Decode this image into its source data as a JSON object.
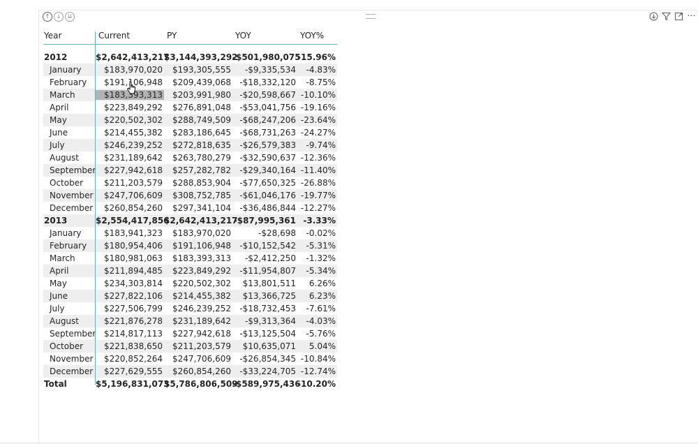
{
  "toolbar": {
    "drill_icons": [
      "drill-up-icon",
      "drill-down-icon",
      "expand-all-icon"
    ],
    "right_icons": [
      "drill-mode-icon",
      "filter-icon",
      "focus-mode-icon",
      "more-options-icon"
    ],
    "more_label": "···"
  },
  "table": {
    "columns": [
      "Year",
      "Current",
      "PY",
      "YOY",
      "YOY%"
    ],
    "rows": [
      {
        "type": "year",
        "cells": [
          "2012",
          "$2,642,413,217",
          "$3,144,393,292",
          "-$501,980,075",
          "-15.96%"
        ]
      },
      {
        "type": "month",
        "cells": [
          "January",
          "$183,970,020",
          "$193,305,555",
          "-$9,335,534",
          "-4.83%"
        ]
      },
      {
        "type": "month",
        "cells": [
          "February",
          "$191,106,948",
          "$209,439,068",
          "-$18,332,120",
          "-8.75%"
        ]
      },
      {
        "type": "month",
        "cells": [
          "March",
          "$183,393,313",
          "$203,991,980",
          "-$20,598,667",
          "-10.10%"
        ],
        "selected_col": 1
      },
      {
        "type": "month",
        "cells": [
          "April",
          "$223,849,292",
          "$276,891,048",
          "-$53,041,756",
          "-19.16%"
        ]
      },
      {
        "type": "month",
        "cells": [
          "May",
          "$220,502,302",
          "$288,749,509",
          "-$68,247,206",
          "-23.64%"
        ]
      },
      {
        "type": "month",
        "cells": [
          "June",
          "$214,455,382",
          "$283,186,645",
          "-$68,731,263",
          "-24.27%"
        ]
      },
      {
        "type": "month",
        "cells": [
          "July",
          "$246,239,252",
          "$272,818,635",
          "-$26,579,383",
          "-9.74%"
        ]
      },
      {
        "type": "month",
        "cells": [
          "August",
          "$231,189,642",
          "$263,780,279",
          "-$32,590,637",
          "-12.36%"
        ]
      },
      {
        "type": "month",
        "cells": [
          "September",
          "$227,942,618",
          "$257,282,782",
          "-$29,340,164",
          "-11.40%"
        ]
      },
      {
        "type": "month",
        "cells": [
          "October",
          "$211,203,579",
          "$288,853,904",
          "-$77,650,325",
          "-26.88%"
        ]
      },
      {
        "type": "month",
        "cells": [
          "November",
          "$247,706,609",
          "$308,752,785",
          "-$61,046,176",
          "-19.77%"
        ]
      },
      {
        "type": "month",
        "cells": [
          "December",
          "$260,854,260",
          "$297,341,104",
          "-$36,486,844",
          "-12.27%"
        ]
      },
      {
        "type": "year",
        "cells": [
          "2013",
          "$2,554,417,856",
          "$2,642,413,217",
          "-$87,995,361",
          "-3.33%"
        ]
      },
      {
        "type": "month",
        "cells": [
          "January",
          "$183,941,323",
          "$183,970,020",
          "-$28,698",
          "-0.02%"
        ]
      },
      {
        "type": "month",
        "cells": [
          "February",
          "$180,954,406",
          "$191,106,948",
          "-$10,152,542",
          "-5.31%"
        ]
      },
      {
        "type": "month",
        "cells": [
          "March",
          "$180,981,063",
          "$183,393,313",
          "-$2,412,250",
          "-1.32%"
        ]
      },
      {
        "type": "month",
        "cells": [
          "April",
          "$211,894,485",
          "$223,849,292",
          "-$11,954,807",
          "-5.34%"
        ]
      },
      {
        "type": "month",
        "cells": [
          "May",
          "$234,303,814",
          "$220,502,302",
          "$13,801,511",
          "6.26%"
        ]
      },
      {
        "type": "month",
        "cells": [
          "June",
          "$227,822,106",
          "$214,455,382",
          "$13,366,725",
          "6.23%"
        ]
      },
      {
        "type": "month",
        "cells": [
          "July",
          "$227,506,799",
          "$246,239,252",
          "-$18,732,453",
          "-7.61%"
        ]
      },
      {
        "type": "month",
        "cells": [
          "August",
          "$221,876,278",
          "$231,189,642",
          "-$9,313,364",
          "-4.03%"
        ]
      },
      {
        "type": "month",
        "cells": [
          "September",
          "$214,817,113",
          "$227,942,618",
          "-$13,125,504",
          "-5.76%"
        ]
      },
      {
        "type": "month",
        "cells": [
          "October",
          "$221,838,650",
          "$211,203,579",
          "$10,635,071",
          "5.04%"
        ]
      },
      {
        "type": "month",
        "cells": [
          "November",
          "$220,852,264",
          "$247,706,609",
          "-$26,854,345",
          "-10.84%"
        ]
      },
      {
        "type": "month",
        "cells": [
          "December",
          "$227,629,555",
          "$260,854,260",
          "-$33,224,705",
          "-12.74%"
        ]
      },
      {
        "type": "total",
        "cells": [
          "Total",
          "$5,196,831,073",
          "$5,786,806,509",
          "-$589,975,436",
          "-10.20%"
        ]
      }
    ]
  },
  "colors": {
    "accent_line": "#5fb2b8",
    "row_alt": "#eeeeee",
    "selected_cell": "#b3b3b3"
  }
}
